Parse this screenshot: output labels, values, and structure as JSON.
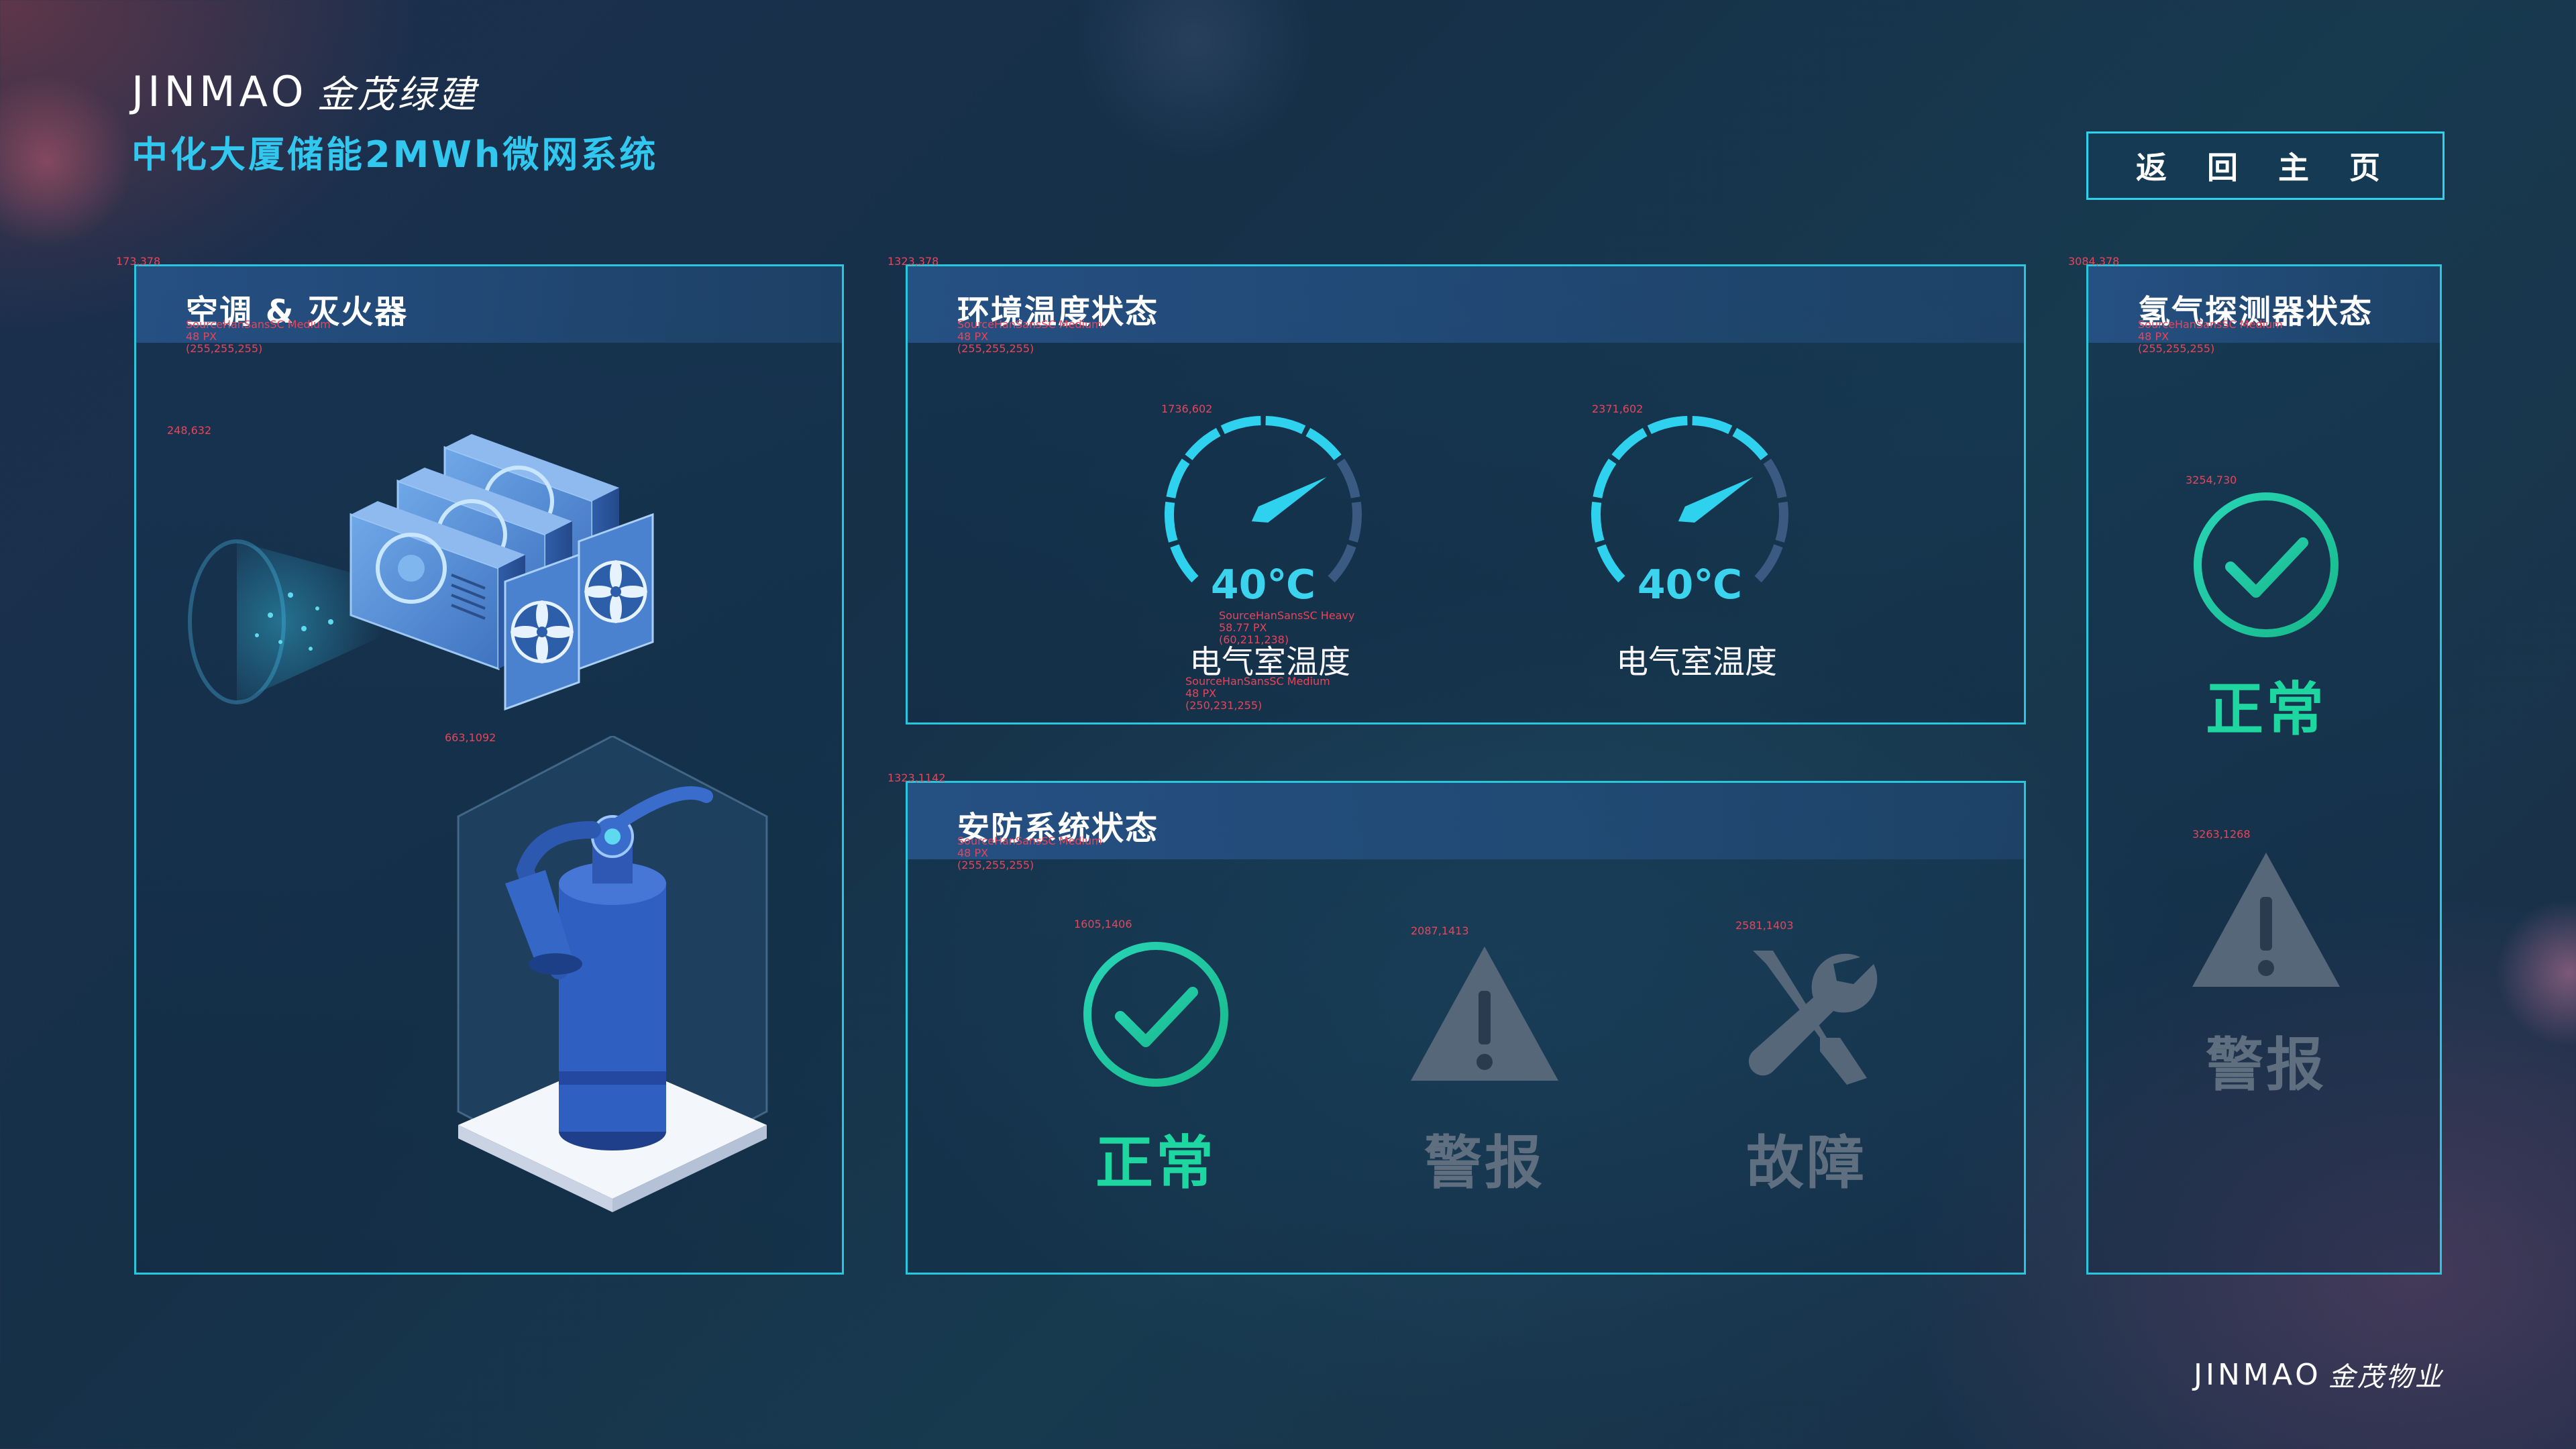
{
  "header": {
    "logo_latin": "JINMAO",
    "logo_cn": "金茂绿建",
    "subtitle": "中化大厦储能2MWh微网系统",
    "home_button": "返 回 主 页"
  },
  "panels": {
    "ac": {
      "title": "空调 & 灭火器",
      "annotations": [
        "173,378",
        "SourceHanSansSC Medium",
        "48 PX",
        "(255,255,255)",
        "248,632",
        "663,1092"
      ]
    },
    "env": {
      "title": "环境温度状态",
      "annotations": [
        "1323,378",
        "SourceHanSansSC Medium",
        "48 PX",
        "(255,255,255)"
      ],
      "gauges": [
        {
          "value": "40℃",
          "label": "电气室温度",
          "level": 0.72,
          "annotations": [
            "1736,602",
            "SourceHanSansSC Heavy",
            "58.77 PX",
            "(60,211,238)",
            "SourceHanSansSC Medium",
            "48 PX",
            "(250,231,255)"
          ]
        },
        {
          "value": "40℃",
          "label": "电气室温度",
          "level": 0.72,
          "annotations": [
            "2371,602"
          ]
        }
      ]
    },
    "security": {
      "title": "安防系统状态",
      "annotations": [
        "1323,1142",
        "SourceHanSansSC Medium",
        "48 PX",
        "(255,255,255)"
      ],
      "items": [
        {
          "label": "正常",
          "state": "active",
          "icon": "check-circle-icon",
          "annotation": "1605,1406"
        },
        {
          "label": "警报",
          "state": "inactive",
          "icon": "warning-icon",
          "annotation": "2087,1413"
        },
        {
          "label": "故障",
          "state": "inactive",
          "icon": "tools-icon",
          "annotation": "2581,1403"
        }
      ]
    },
    "hydrogen": {
      "title": "氢气探测器状态",
      "annotations": [
        "3084,378",
        "SourceHanSansSC Medium",
        "48 PX",
        "(255,255,255)",
        "3254,730",
        "3263,1268"
      ],
      "items": [
        {
          "label": "正常",
          "state": "active",
          "icon": "check-circle-icon"
        },
        {
          "label": "警报",
          "state": "inactive",
          "icon": "warning-icon"
        }
      ]
    }
  },
  "footer": {
    "logo_latin": "JINMAO",
    "logo_cn": "金茂物业"
  },
  "colors": {
    "accent": "#2fd2ee",
    "ok": "#1ed6a0",
    "inactive": "#5f6f80",
    "annotation": "#e6455a"
  }
}
